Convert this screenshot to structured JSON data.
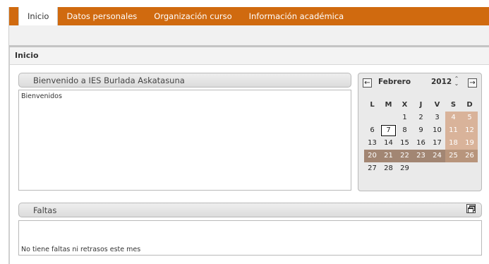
{
  "nav": {
    "tabs": [
      {
        "label": "Inicio",
        "active": true
      },
      {
        "label": "Datos personales"
      },
      {
        "label": "Organización curso"
      },
      {
        "label": "Información académica"
      }
    ]
  },
  "page": {
    "title": "Inicio"
  },
  "welcome_panel": {
    "title": "Bienvenido a  IES Burlada Askatasuna",
    "body": "Bienvenidos"
  },
  "calendar": {
    "month": "Febrero",
    "year": "2012",
    "prev_icon": "←",
    "next_icon": "→",
    "spin_icon": "⇕",
    "weekdays": [
      "L",
      "M",
      "X",
      "J",
      "V",
      "S",
      "D"
    ],
    "today": "7",
    "highlighted_week": [
      "20",
      "21",
      "22",
      "23",
      "24",
      "25",
      "26"
    ],
    "weeks": [
      [
        "",
        "",
        "1",
        "2",
        "3",
        "4",
        "5"
      ],
      [
        "6",
        "7",
        "8",
        "9",
        "10",
        "11",
        "12"
      ],
      [
        "13",
        "14",
        "15",
        "16",
        "17",
        "18",
        "19"
      ],
      [
        "20",
        "21",
        "22",
        "23",
        "24",
        "25",
        "26"
      ],
      [
        "27",
        "28",
        "29",
        "",
        "",
        "",
        ""
      ]
    ]
  },
  "faltas_panel": {
    "title": "Faltas",
    "body": "No tiene faltas ni retrasos este mes",
    "maximize_icon": "maximize-icon"
  }
}
